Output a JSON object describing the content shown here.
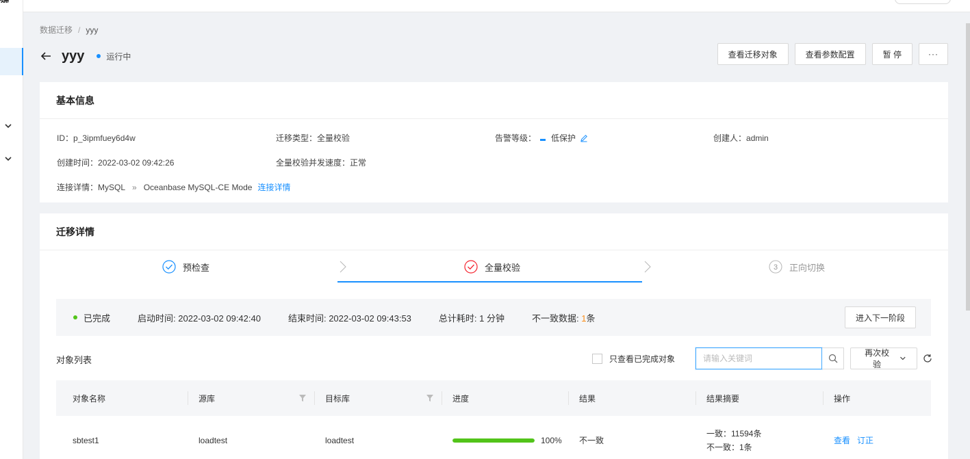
{
  "nav": {
    "logo_fragment": "欲"
  },
  "breadcrumb": {
    "root": "数据迁移",
    "separator": "/",
    "current": "yyy"
  },
  "header": {
    "title": "yyy",
    "status": "运行中",
    "actions": {
      "view_objects": "查看迁移对象",
      "view_params": "查看参数配置",
      "pause": "暂 停",
      "more": "···"
    }
  },
  "basic_info": {
    "title": "基本信息",
    "id_label": "ID：",
    "id_value": "p_3ipmfuey6d4w",
    "type_label": "迁移类型：",
    "type_value": "全量校验",
    "alarm_label": "告警等级：",
    "alarm_value": "低保护",
    "creator_label": "创建人：",
    "creator_value": "admin",
    "created_label": "创建时间：",
    "created_value": "2022-03-02 09:42:26",
    "speed_label": "全量校验并发速度：",
    "speed_value": "正常",
    "conn_label": "连接详情：",
    "conn_source": "MySQL",
    "conn_arrow": "»",
    "conn_target": "Oceanbase MySQL-CE Mode",
    "conn_link": "连接详情"
  },
  "migration": {
    "title": "迁移详情",
    "steps": [
      {
        "label": "预检查",
        "state": "done"
      },
      {
        "label": "全量校验",
        "state": "active"
      },
      {
        "label": "正向切换",
        "number": "3",
        "state": "pending"
      }
    ],
    "summary": {
      "status": "已完成",
      "start_label": "启动时间: ",
      "start_value": "2022-03-02 09:42:40",
      "end_label": "结束时间: ",
      "end_value": "2022-03-02 09:43:53",
      "duration_label": "总计耗时: ",
      "duration_value": "1 分钟",
      "diff_label": "不一致数据: ",
      "diff_count": "1",
      "diff_unit": "条",
      "next_button": "进入下一阶段"
    },
    "object_list": {
      "title": "对象列表",
      "only_done_label": "只查看已完成对象",
      "search_placeholder": "请输入关键词",
      "recheck_button": "再次校验",
      "columns": [
        "对象名称",
        "源库",
        "目标库",
        "进度",
        "结果",
        "结果摘要",
        "操作"
      ],
      "rows": [
        {
          "name": "sbtest1",
          "source": "loadtest",
          "target": "loadtest",
          "progress": 1.0,
          "progress_label": "100%",
          "result": "不一致",
          "summary_line1": "一致：11594条",
          "summary_line2": "不一致：1条",
          "action_view": "查看",
          "action_fix": "订正"
        }
      ]
    }
  },
  "colors": {
    "primary": "#1890ff",
    "success": "#52c41a",
    "warning": "#fa8c16",
    "danger": "#f5222d"
  }
}
